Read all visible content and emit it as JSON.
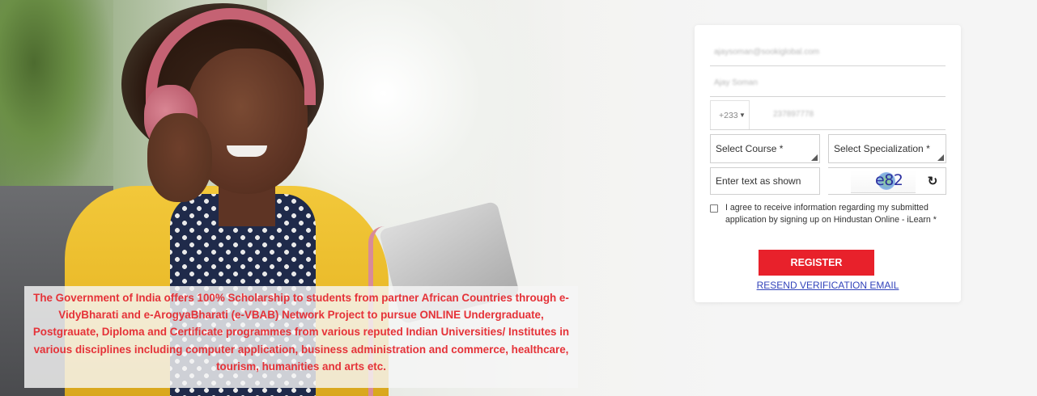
{
  "hero": {
    "caption": "The Government of India offers 100% Scholarship to students from partner African Countries through e-VidyBharati and e-ArogyaBharati (e-VBAB) Network Project to pursue ONLINE Undergraduate, Postgrauate, Diploma and Certificate programmes from various reputed Indian Universities/ Institutes in various disciplines including computer application, business administration and commerce, healthcare, tourism, humanities and arts etc."
  },
  "form": {
    "email_value": "ajaysoman@sookiglobal.com",
    "name_value": "Ajay Soman",
    "phone_code": "+233",
    "phone_value": "237897778",
    "course_select": "Select Course *",
    "specialization_select": "Select Specialization *",
    "captcha_placeholder": "Enter text as shown",
    "captcha_text": "e82",
    "agree_text": "I agree to receive information regarding my submitted application by signing up on Hindustan Online - iLearn *",
    "register_label": "REGISTER",
    "resend_label": "RESEND VERIFICATION EMAIL"
  },
  "colors": {
    "accent_red": "#e8212b",
    "caption_red": "#e53238",
    "link_blue": "#3344bb"
  },
  "icons": [
    "chevron-down-icon",
    "refresh-icon",
    "checkbox"
  ]
}
